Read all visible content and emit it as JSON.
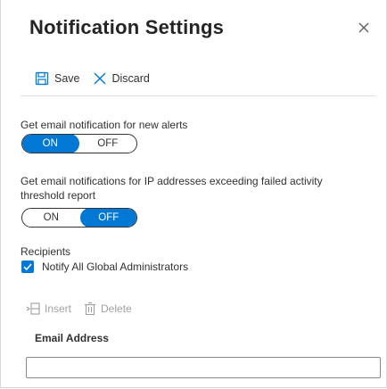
{
  "dialog": {
    "title": "Notification Settings"
  },
  "toolbar": {
    "save_label": "Save",
    "discard_label": "Discard"
  },
  "alerts_setting": {
    "label": "Get email notification for new alerts",
    "on_label": "ON",
    "off_label": "OFF",
    "selected": "ON"
  },
  "ip_setting": {
    "label_line1": "Get email notifications for IP addresses exceeding failed activity",
    "label_line2": "threshold report",
    "on_label": "ON",
    "off_label": "OFF",
    "selected": "OFF"
  },
  "recipients": {
    "heading": "Recipients",
    "notify_label": "Notify All Global Administrators",
    "notify_checked": true
  },
  "table_toolbar": {
    "insert_label": "Insert",
    "delete_label": "Delete"
  },
  "table": {
    "column_header": "Email Address",
    "input_value": ""
  },
  "icons": {
    "close": "close-icon",
    "save": "save-icon",
    "discard": "discard-icon",
    "insert": "insert-row-icon",
    "delete": "trash-icon",
    "check": "checkmark-icon"
  },
  "colors": {
    "accent": "#0078d4",
    "disabled": "#a19f9d"
  }
}
